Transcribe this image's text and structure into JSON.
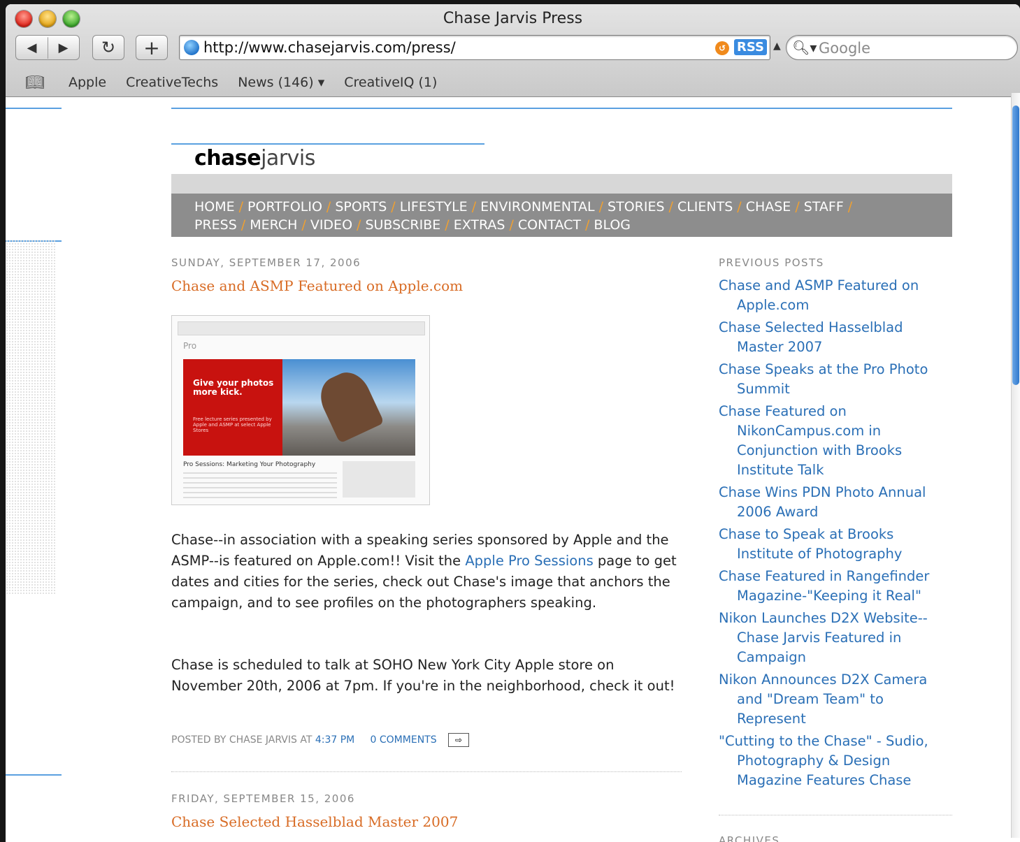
{
  "window": {
    "title": "Chase Jarvis Press"
  },
  "toolbar": {
    "back": "◀",
    "forward": "▶",
    "reload": "↻",
    "add": "+",
    "url": "http://www.chasejarvis.com/press/",
    "rss": "RSS",
    "search_placeholder": "Google"
  },
  "bookmarks": [
    "Apple",
    "CreativeTechs",
    "News (146) ▾",
    "CreativeIQ (1)"
  ],
  "site": {
    "logo_bold": "chase",
    "logo_light": "jarvis",
    "nav_line1": [
      "HOME",
      "PORTFOLIO",
      "SPORTS",
      "LIFESTYLE",
      "ENVIRONMENTAL",
      "STORIES",
      "CLIENTS",
      "CHASE",
      "STAFF"
    ],
    "nav_line2": [
      "PRESS",
      "MERCH",
      "VIDEO",
      "SUBSCRIBE",
      "EXTRAS",
      "CONTACT",
      "BLOG"
    ]
  },
  "post1": {
    "date": "SUNDAY, SEPTEMBER 17, 2006",
    "title": "Chase and ASMP Featured on Apple.com",
    "image": {
      "pro": "Pro",
      "headline": "Give your photos more kick.",
      "sub": "Free lecture series presented by Apple and ASMP at select Apple Stores",
      "foot": "Pro Sessions: Marketing Your Photography"
    },
    "para1_a": "Chase--in association with a speaking series sponsored by Apple and the ASMP--is featured on Apple.com!! Visit the ",
    "para1_link": "Apple Pro Sessions",
    "para1_b": " page to get dates and cities for the series, check out Chase's image that anchors the campaign, and to see profiles on the photographers speaking.",
    "para2": "Chase is scheduled to talk at SOHO New York City Apple store on November 20th, 2006 at 7pm. If you're in the neighborhood, check it out!",
    "posted_by": "POSTED BY CHASE JARVIS AT ",
    "time": "4:37 PM",
    "comments": "0 COMMENTS"
  },
  "post2": {
    "date": "FRIDAY, SEPTEMBER 15, 2006",
    "title": "Chase Selected Hasselblad Master 2007"
  },
  "sidebar": {
    "previous_heading": "PREVIOUS POSTS",
    "previous": [
      "Chase and ASMP Featured on Apple.com",
      "Chase Selected Hasselblad Master 2007",
      "Chase Speaks at the Pro Photo Summit",
      "Chase Featured on NikonCampus.com in Conjunction with Brooks Institute Talk",
      "Chase Wins PDN Photo Annual 2006 Award",
      "Chase to Speak at Brooks Institute of Photography",
      "Chase Featured in Rangefinder Magazine-\"Keeping it Real\"",
      "Nikon Launches D2X Website--Chase Jarvis Featured in Campaign",
      "Nikon Announces D2X Camera and \"Dream Team\" to Represent",
      "\"Cutting to the Chase\" - Sudio, Photography & Design Magazine Features Chase"
    ],
    "archives_heading": "ARCHIVES"
  }
}
